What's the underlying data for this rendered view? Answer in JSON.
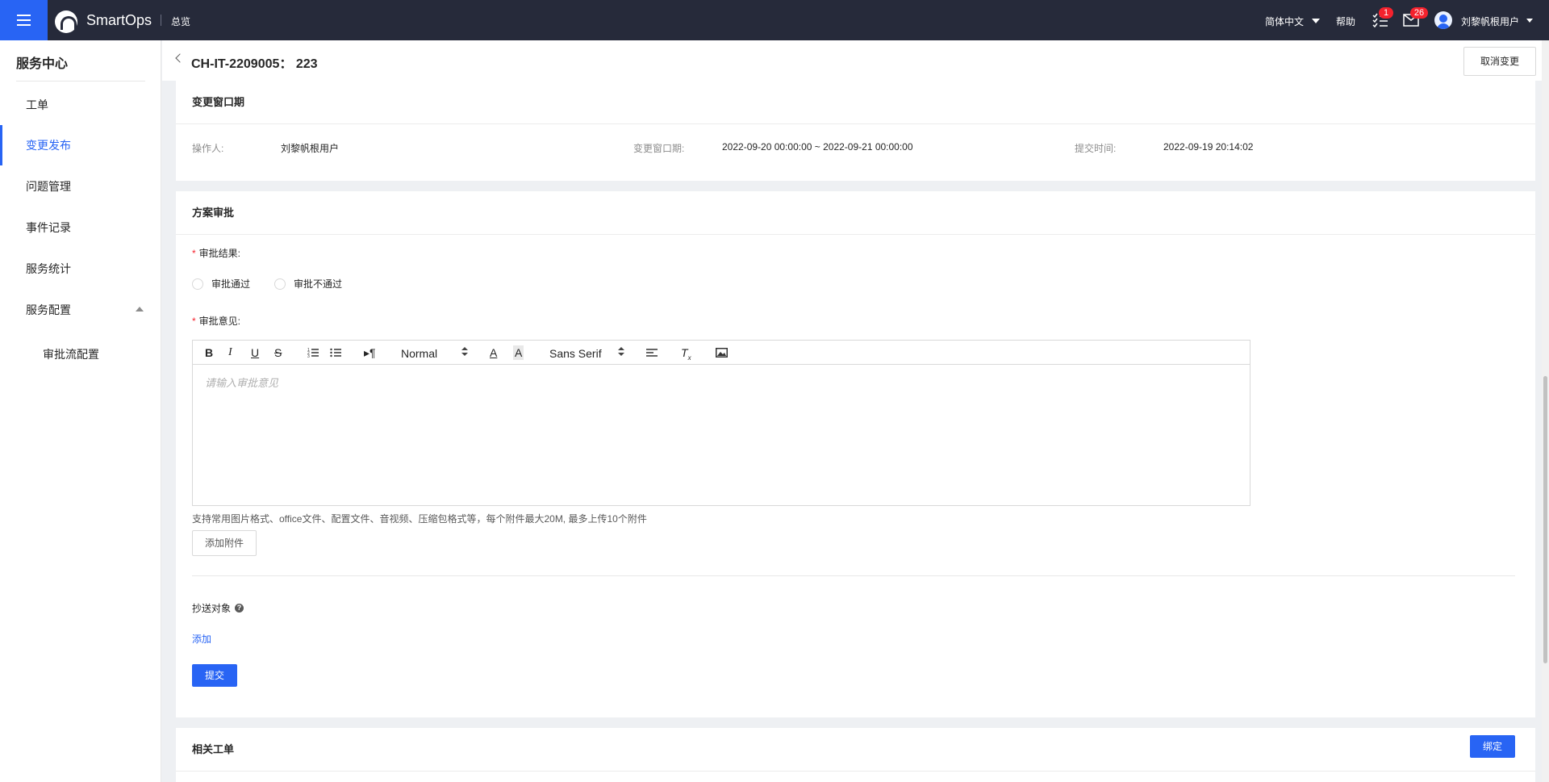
{
  "topbar": {
    "brand": "SmartOps",
    "overview": "总览",
    "language": "简体中文",
    "help": "帮助",
    "todo_count": "1",
    "mail_count": "26",
    "username": "刘黎帆根用户"
  },
  "sidebar": {
    "title": "服务中心",
    "items": [
      {
        "label": "工单"
      },
      {
        "label": "变更发布"
      },
      {
        "label": "问题管理"
      },
      {
        "label": "事件记录"
      },
      {
        "label": "服务统计"
      },
      {
        "label": "服务配置"
      }
    ],
    "sub_items": [
      {
        "label": "审批流配置"
      }
    ]
  },
  "header": {
    "title": "CH-IT-2209005：  223",
    "cancel_label": "取消变更"
  },
  "window_card": {
    "title": "变更窗口期",
    "operator_label": "操作人:",
    "operator_value": "刘黎帆根用户",
    "window_label": "变更窗口期:",
    "window_value": "2022-09-20 00:00:00 ~ 2022-09-21 00:00:00",
    "submit_time_label": "提交时间:",
    "submit_time_value": "2022-09-19 20:14:02"
  },
  "approval_card": {
    "title": "方案审批",
    "result_label": "审批结果:",
    "option_pass": "审批通过",
    "option_reject": "审批不通过",
    "opinion_label": "审批意见:",
    "editor": {
      "header_select": "Normal",
      "font_select": "Sans Serif",
      "placeholder": "请输入审批意见"
    },
    "attach_hint": "支持常用图片格式、office文件、配置文件、音视频、压缩包格式等，每个附件最大20M, 最多上传10个附件",
    "attach_button": "添加附件",
    "cc_label": "抄送对象",
    "cc_add": "添加",
    "submit_button": "提交"
  },
  "related_card": {
    "title": "相关工单",
    "bind_button": "绑定"
  }
}
